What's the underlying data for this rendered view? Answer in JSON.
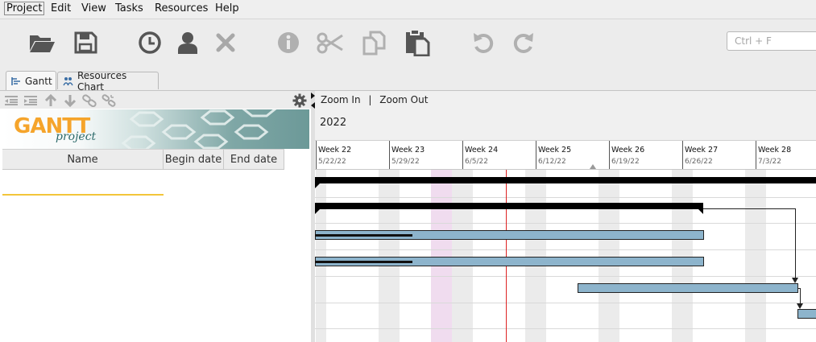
{
  "menu": [
    {
      "label": "Project",
      "active": true
    },
    {
      "label": "Edit"
    },
    {
      "label": "View"
    },
    {
      "label": "Tasks"
    },
    {
      "label": "Resources"
    },
    {
      "label": "Help"
    }
  ],
  "toolbar": {
    "buttons": [
      {
        "name": "open-folder-icon",
        "enabled": true
      },
      {
        "name": "save-icon",
        "enabled": true
      },
      {
        "name": "clock-icon",
        "enabled": true
      },
      {
        "name": "user-icon",
        "enabled": true
      },
      {
        "name": "delete-icon",
        "enabled": false
      },
      {
        "name": "info-icon",
        "enabled": false
      },
      {
        "name": "cut-icon",
        "enabled": false
      },
      {
        "name": "copy-icon",
        "enabled": false
      },
      {
        "name": "paste-icon",
        "enabled": true
      },
      {
        "name": "undo-icon",
        "enabled": false
      },
      {
        "name": "redo-icon",
        "enabled": false
      }
    ],
    "search_placeholder": "Ctrl + F"
  },
  "tabs": [
    {
      "label": "Gantt",
      "active": true,
      "icon": "gantt-tab-icon"
    },
    {
      "label": "Resources Chart",
      "active": false,
      "icon": "resources-tab-icon"
    }
  ],
  "tree_toolbar": [
    "outdent-icon",
    "indent-icon",
    "move-up-icon",
    "move-down-icon",
    "link-icon",
    "unlink-icon"
  ],
  "logo": {
    "main": "GANTT",
    "sub": "project"
  },
  "table": {
    "columns": [
      "Name",
      "Begin date",
      "End date"
    ]
  },
  "chart": {
    "zoom_in": "Zoom In",
    "separator": "|",
    "zoom_out": "Zoom Out",
    "year": "2022",
    "weeks": [
      {
        "label": "Week 22",
        "date": "5/22/22"
      },
      {
        "label": "Week 23",
        "date": "5/29/22"
      },
      {
        "label": "Week 24",
        "date": "6/5/22"
      },
      {
        "label": "Week 25",
        "date": "6/12/22"
      },
      {
        "label": "Week 26",
        "date": "6/19/22"
      },
      {
        "label": "Week 27",
        "date": "6/26/22"
      },
      {
        "label": "Week 28",
        "date": "7/3/22"
      }
    ]
  },
  "colors": {
    "task_fill": "#8db4cc",
    "today_line": "#dd2222",
    "selection": "#f3c53a",
    "holiday": "#f0dcef",
    "weekend": "#ebebeb"
  }
}
